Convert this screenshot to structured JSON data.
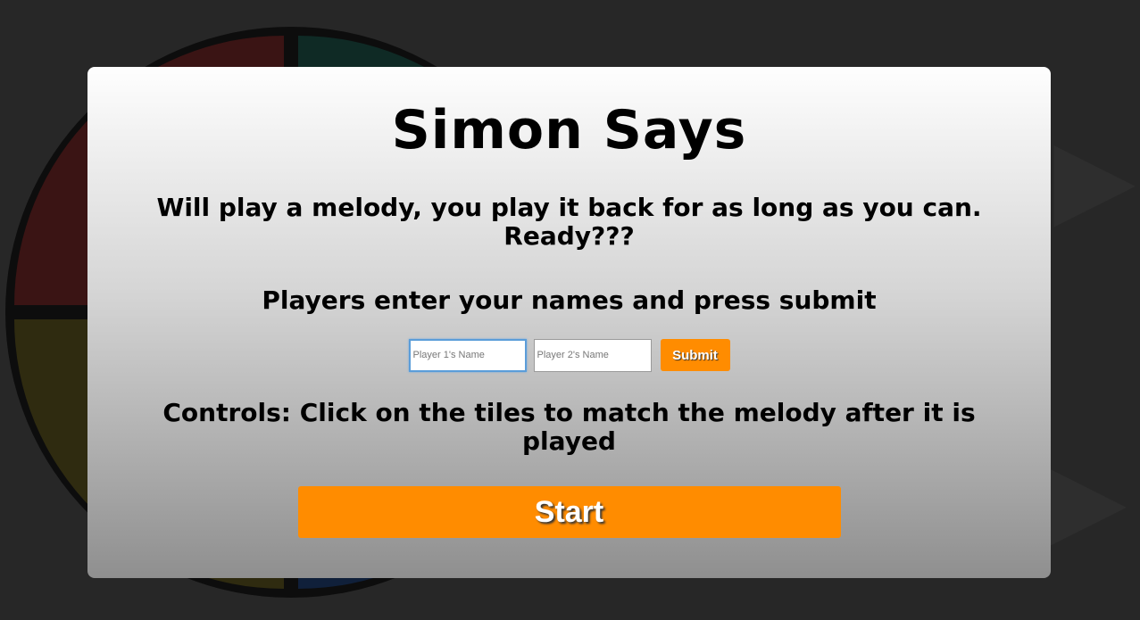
{
  "modal": {
    "title": "Simon Says",
    "intro": "Will play a melody, you play it back for as long as you can. Ready???",
    "players_heading": "Players enter your names and press submit",
    "player1_placeholder": "Player 1's Name",
    "player2_placeholder": "Player 2's Name",
    "submit_label": "Submit",
    "controls_text": "Controls: Click on the tiles to match the melody after it is played",
    "start_label": "Start"
  },
  "colors": {
    "accent": "#ff8c00",
    "background": "#272727",
    "focus_ring": "#5b9dd9"
  },
  "icons": {
    "background_glyph": "play-icon"
  }
}
